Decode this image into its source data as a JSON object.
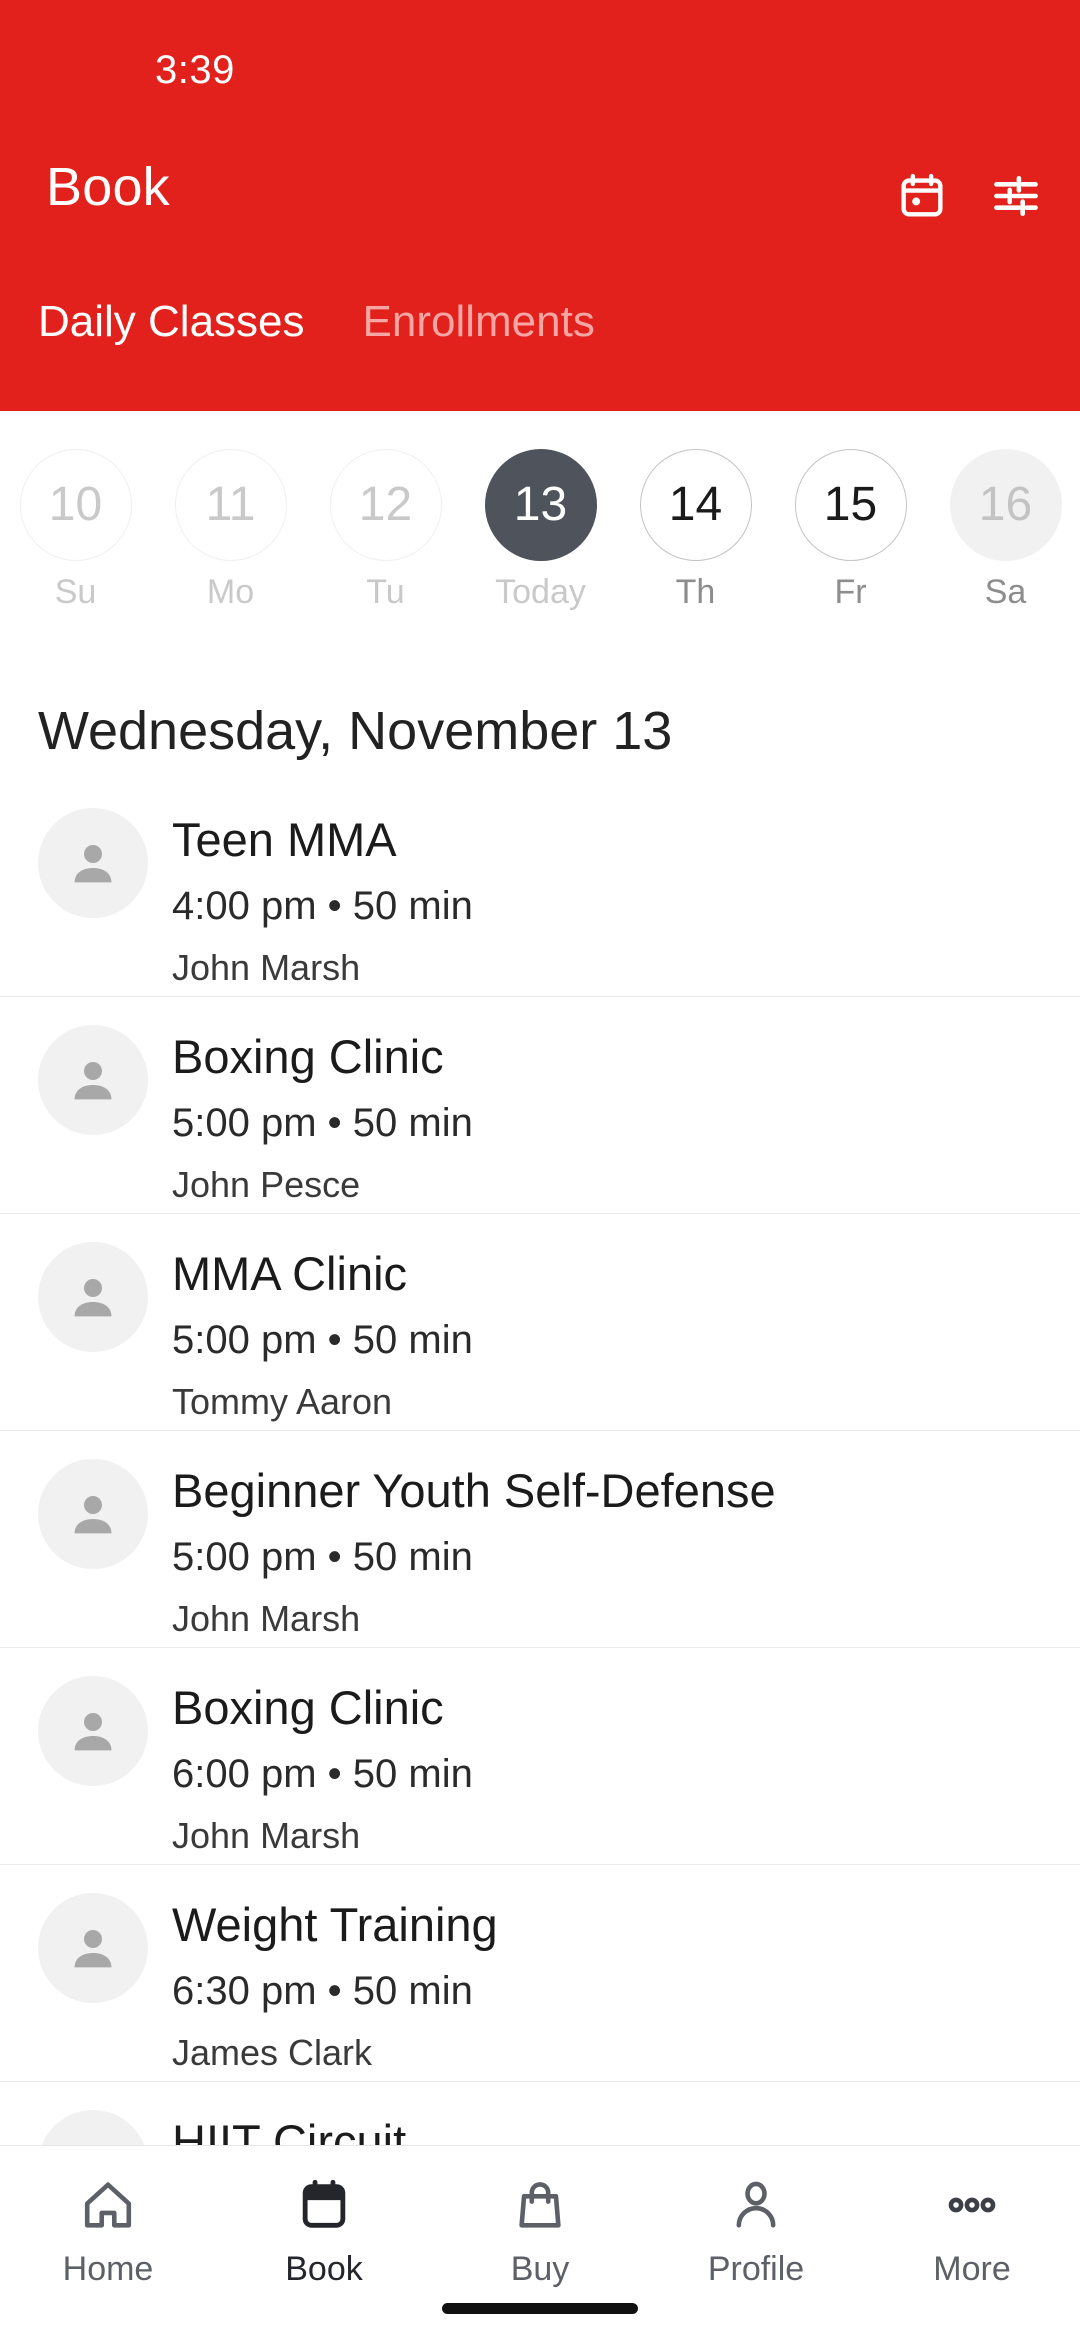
{
  "status_bar": {
    "time": "3:39"
  },
  "header": {
    "title": "Book",
    "background_color": "#E2211C",
    "actions": [
      {
        "name": "calendar-icon",
        "label": "Calendar"
      },
      {
        "name": "filter-icon",
        "label": "Filters"
      }
    ],
    "tabs": [
      {
        "label": "Daily Classes",
        "active": true
      },
      {
        "label": "Enrollments",
        "active": false
      }
    ]
  },
  "date_strip": {
    "selected_color": "#4E535C",
    "dates": [
      {
        "day": "10",
        "weekday": "Su",
        "state": "past"
      },
      {
        "day": "11",
        "weekday": "Mo",
        "state": "past"
      },
      {
        "day": "12",
        "weekday": "Tu",
        "state": "past"
      },
      {
        "day": "13",
        "weekday": "Today",
        "state": "today"
      },
      {
        "day": "14",
        "weekday": "Th",
        "state": "future"
      },
      {
        "day": "15",
        "weekday": "Fr",
        "state": "future"
      },
      {
        "day": "16",
        "weekday": "Sa",
        "state": "edge"
      }
    ]
  },
  "day_heading": "Wednesday, November 13",
  "classes": [
    {
      "name": "Teen MMA",
      "time": "4:00 pm • 50 min",
      "coach": "John Marsh"
    },
    {
      "name": "Boxing Clinic",
      "time": "5:00 pm • 50 min",
      "coach": "John Pesce"
    },
    {
      "name": "MMA Clinic",
      "time": "5:00 pm • 50 min",
      "coach": "Tommy Aaron"
    },
    {
      "name": "Beginner Youth Self-Defense",
      "time": "5:00 pm • 50 min",
      "coach": "John Marsh"
    },
    {
      "name": "Boxing Clinic",
      "time": "6:00 pm • 50 min",
      "coach": "John Marsh"
    },
    {
      "name": "Weight Training",
      "time": "6:30 pm • 50 min",
      "coach": "James Clark"
    },
    {
      "name": "HIIT Circuit",
      "time": "",
      "coach": ""
    }
  ],
  "bottom_nav": {
    "items": [
      {
        "label": "Home",
        "icon": "home-icon",
        "active": false
      },
      {
        "label": "Book",
        "icon": "calendar-icon",
        "active": true
      },
      {
        "label": "Buy",
        "icon": "bag-icon",
        "active": false
      },
      {
        "label": "Profile",
        "icon": "person-icon",
        "active": false
      },
      {
        "label": "More",
        "icon": "more-icon",
        "active": false
      }
    ]
  }
}
